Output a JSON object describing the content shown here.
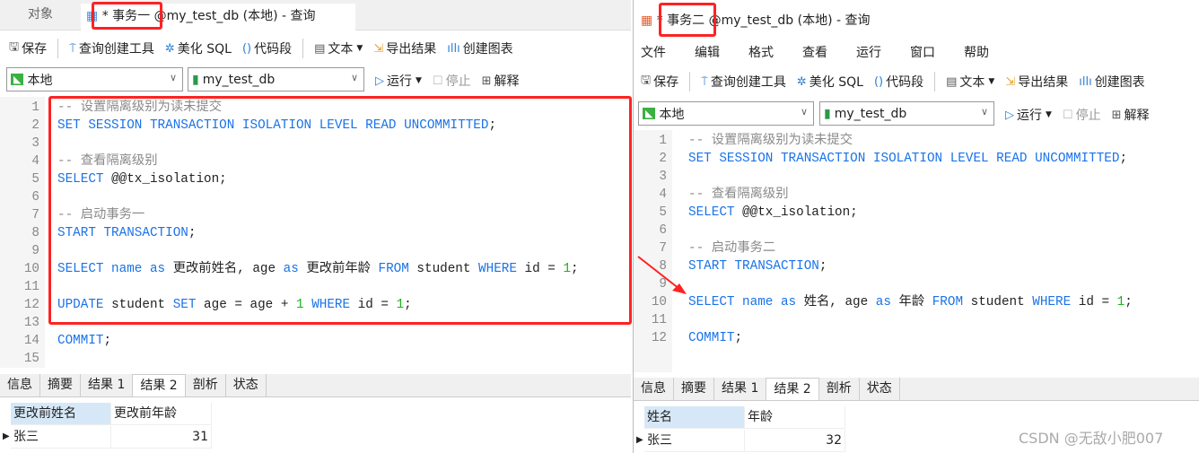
{
  "left": {
    "tabs": {
      "objects": "对象",
      "query": "* 事务一 @my_test_db (本地) - 查询"
    },
    "toolbar": {
      "save": "保存",
      "query_builder": "查询创建工具",
      "beautify": "美化 SQL",
      "snippet": "代码段",
      "text": "文本",
      "export": "导出结果",
      "chart": "创建图表"
    },
    "connection": "本地",
    "database": "my_test_db",
    "run": "运行",
    "stop": "停止",
    "explain": "解释",
    "line_numbers": [
      "1",
      "2",
      "3",
      "4",
      "5",
      "6",
      "7",
      "8",
      "9",
      "10",
      "11",
      "12",
      "13",
      "14",
      "15"
    ],
    "code": [
      [
        [
          "cm",
          "-- 设置隔离级别为读未提交"
        ]
      ],
      [
        [
          "kw",
          "SET SESSION TRANSACTION ISOLATION LEVEL READ UNCOMMITTED"
        ],
        [
          "tx",
          ";"
        ]
      ],
      [],
      [
        [
          "cm",
          "-- 查看隔离级别"
        ]
      ],
      [
        [
          "kw",
          "SELECT"
        ],
        [
          "tx",
          " @@tx_isolation;"
        ]
      ],
      [],
      [
        [
          "cm",
          "-- 启动事务一"
        ]
      ],
      [
        [
          "kw",
          "START TRANSACTION"
        ],
        [
          "tx",
          ";"
        ]
      ],
      [],
      [
        [
          "kw",
          "SELECT name as"
        ],
        [
          "tx",
          " 更改前姓名, age "
        ],
        [
          "kw",
          "as"
        ],
        [
          "tx",
          " 更改前年龄 "
        ],
        [
          "kw",
          "FROM"
        ],
        [
          "tx",
          " student "
        ],
        [
          "kw",
          "WHERE"
        ],
        [
          "tx",
          " id = "
        ],
        [
          "num",
          "1"
        ],
        [
          "tx",
          ";"
        ]
      ],
      [],
      [
        [
          "kw",
          "UPDATE"
        ],
        [
          "tx",
          " student "
        ],
        [
          "kw",
          "SET"
        ],
        [
          "tx",
          " age = age + "
        ],
        [
          "num",
          "1"
        ],
        [
          "tx",
          " "
        ],
        [
          "kw",
          "WHERE"
        ],
        [
          "tx",
          " id = "
        ],
        [
          "num",
          "1"
        ],
        [
          "tx",
          ";"
        ]
      ],
      [],
      [
        [
          "kw",
          "COMMIT"
        ],
        [
          "tx",
          ";"
        ]
      ],
      []
    ],
    "result_tabs": [
      "信息",
      "摘要",
      "结果 1",
      "结果 2",
      "剖析",
      "状态"
    ],
    "active_result_tab": "结果 2",
    "columns": [
      "更改前姓名",
      "更改前年龄"
    ],
    "rows": [
      [
        "张三",
        "31"
      ]
    ]
  },
  "right": {
    "title": "* 事务二 @my_test_db (本地) - 查询",
    "menu": [
      "文件",
      "编辑",
      "格式",
      "查看",
      "运行",
      "窗口",
      "帮助"
    ],
    "toolbar": {
      "save": "保存",
      "query_builder": "查询创建工具",
      "beautify": "美化 SQL",
      "snippet": "代码段",
      "text": "文本",
      "export": "导出结果",
      "chart": "创建图表"
    },
    "connection": "本地",
    "database": "my_test_db",
    "run": "运行",
    "stop": "停止",
    "explain": "解释",
    "line_numbers": [
      "1",
      "2",
      "3",
      "4",
      "5",
      "6",
      "7",
      "8",
      "9",
      "10",
      "11",
      "12"
    ],
    "code": [
      [
        [
          "cm",
          "-- 设置隔离级别为读未提交"
        ]
      ],
      [
        [
          "kw",
          "SET SESSION TRANSACTION ISOLATION LEVEL READ UNCOMMITTED"
        ],
        [
          "tx",
          ";"
        ]
      ],
      [],
      [
        [
          "cm",
          "-- 查看隔离级别"
        ]
      ],
      [
        [
          "kw",
          "SELECT"
        ],
        [
          "tx",
          " @@tx_isolation;"
        ]
      ],
      [],
      [
        [
          "cm",
          "-- 启动事务二"
        ]
      ],
      [
        [
          "kw",
          "START TRANSACTION"
        ],
        [
          "tx",
          ";"
        ]
      ],
      [],
      [
        [
          "kw",
          "SELECT name as"
        ],
        [
          "tx",
          " 姓名, age "
        ],
        [
          "kw",
          "as"
        ],
        [
          "tx",
          " 年龄 "
        ],
        [
          "kw",
          "FROM"
        ],
        [
          "tx",
          " student "
        ],
        [
          "kw",
          "WHERE"
        ],
        [
          "tx",
          " id = "
        ],
        [
          "num",
          "1"
        ],
        [
          "tx",
          ";"
        ]
      ],
      [],
      [
        [
          "kw",
          "COMMIT"
        ],
        [
          "tx",
          ";"
        ]
      ]
    ],
    "result_tabs": [
      "信息",
      "摘要",
      "结果 1",
      "结果 2",
      "剖析",
      "状态"
    ],
    "active_result_tab": "结果 2",
    "columns": [
      "姓名",
      "年龄"
    ],
    "rows": [
      [
        "张三",
        "32"
      ]
    ]
  },
  "watermark": "CSDN @无敌小肥007",
  "colors": {
    "keyword": "#1a73e8",
    "comment": "#8a8a8a",
    "number": "#18b418",
    "highlight": "#ff2222"
  }
}
